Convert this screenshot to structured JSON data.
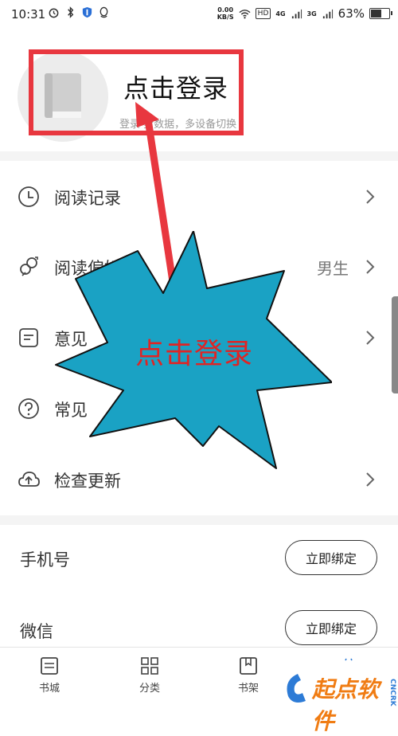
{
  "status_bar": {
    "time": "10:31",
    "net_speed_value": "0.00",
    "net_speed_unit": "KB/S",
    "hd_label": "HD",
    "signal_4g": "4G",
    "signal_3g": "3G",
    "battery_percent": 63,
    "battery_label": "63%"
  },
  "profile": {
    "login_title": "点击登录",
    "login_subtitle": "登录 步数据，多设备切换"
  },
  "menu": [
    {
      "label": "阅读记录",
      "value": "",
      "icon": "clock-icon"
    },
    {
      "label": "阅读偏好",
      "value": "男生",
      "icon": "gender-icon"
    },
    {
      "label": "意见",
      "value": "",
      "icon": "feedback-icon"
    },
    {
      "label": "常见",
      "value": "",
      "icon": "help-icon"
    },
    {
      "label": "检查更新",
      "value": "",
      "icon": "cloud-upload-icon"
    }
  ],
  "bindings": [
    {
      "label": "手机号",
      "button": "立即绑定"
    },
    {
      "label": "微信",
      "button": "立即绑定"
    }
  ],
  "bottom_nav": [
    {
      "label": "书城",
      "icon": "bookstore-icon"
    },
    {
      "label": "分类",
      "icon": "grid-icon"
    },
    {
      "label": "书架",
      "icon": "bookshelf-icon"
    }
  ],
  "annotation": {
    "burst_text": "点击登录",
    "highlight_color": "#e8373f",
    "burst_color": "#1aa2c4"
  },
  "watermark": {
    "text": "起点软件",
    "side_text": "CNCRK"
  }
}
